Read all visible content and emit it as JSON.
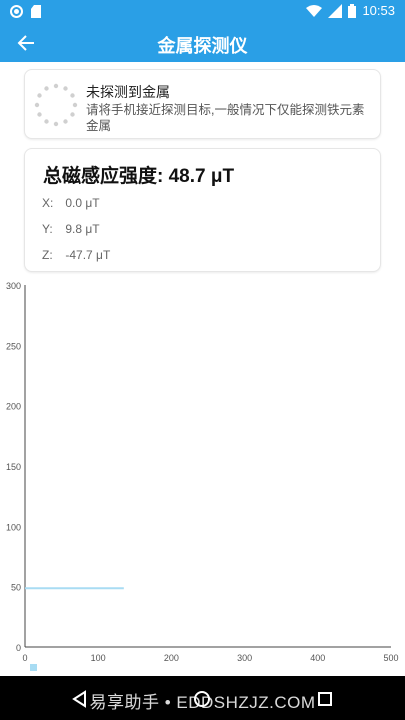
{
  "status_bar": {
    "time": "10:53"
  },
  "app_bar": {
    "title": "金属探测仪"
  },
  "status_card": {
    "title": "未探测到金属",
    "description": "请将手机接近探测目标,一般情况下仅能探测铁元素金属"
  },
  "reading": {
    "total_label": "总磁感应强度:",
    "total_value": "48.7 μT",
    "x_label": "X:",
    "x_value": "0.0 μT",
    "y_label": "Y:",
    "y_value": "9.8 μT",
    "z_label": "Z:",
    "z_value": "-47.7 μT"
  },
  "colors": {
    "primary": "#2a9fe6",
    "series": "#a8dcf3"
  },
  "chart_data": {
    "type": "line",
    "xlim": [
      0,
      500
    ],
    "ylim": [
      0,
      300
    ],
    "x_ticks": [
      "0",
      "100",
      "200",
      "300",
      "400",
      "500"
    ],
    "y_ticks": [
      "0",
      "50",
      "100",
      "150",
      "200",
      "250",
      "300"
    ],
    "grid": false,
    "legend": "bottom-left",
    "series": [
      {
        "x": [
          0,
          135
        ],
        "y": [
          48.7,
          48.7
        ]
      }
    ]
  },
  "nav_bar": {
    "watermark": "易享助手 • EDDSHZJZ.COM"
  }
}
